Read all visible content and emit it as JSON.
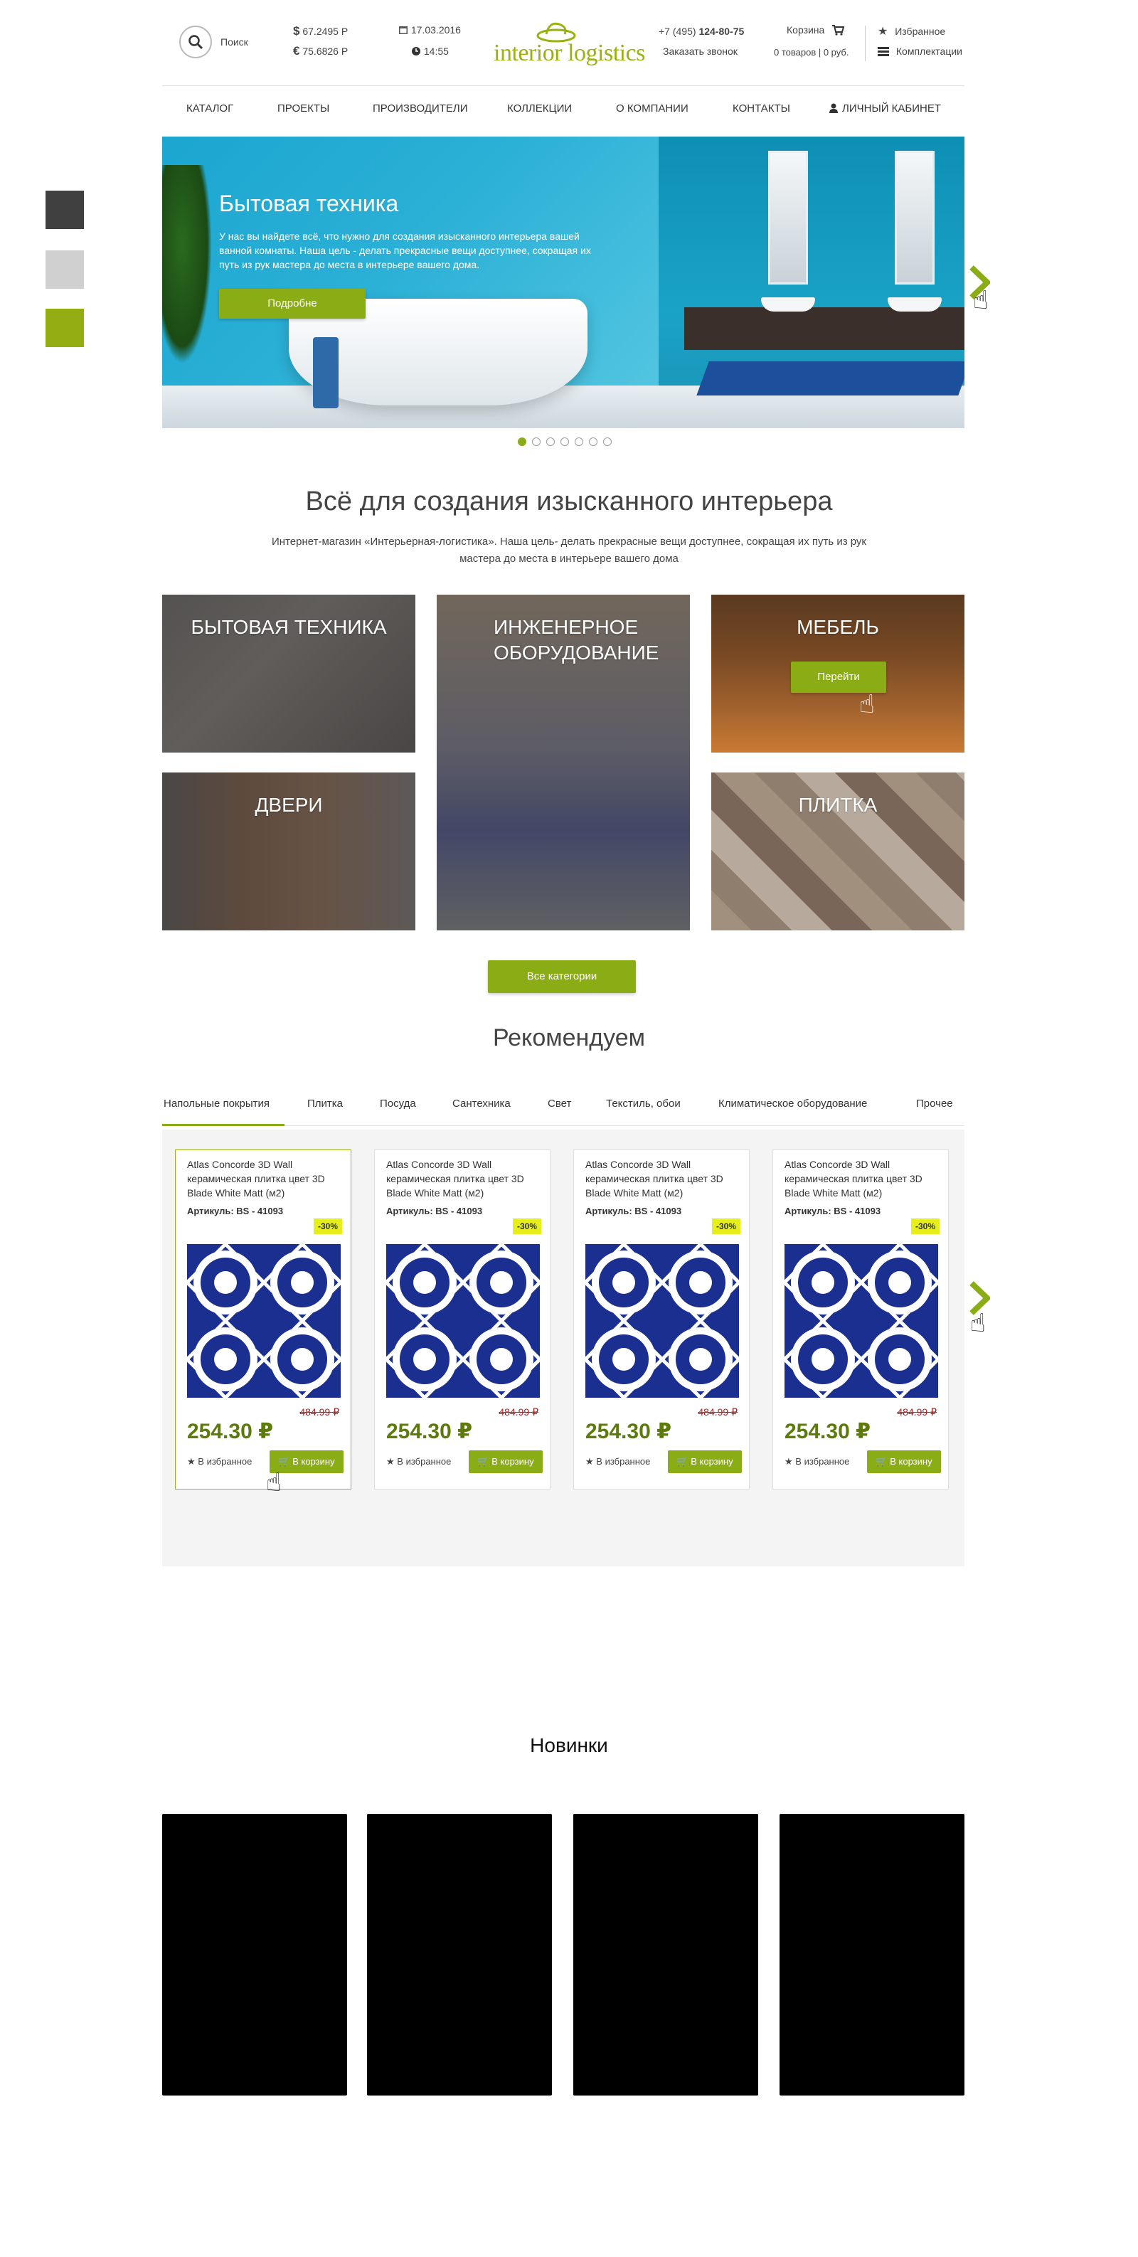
{
  "colors": {
    "accent": "#8aac14",
    "swatch_dark": "#404040",
    "swatch_light": "#d0d0d0",
    "swatch_green": "#94ad12",
    "sale_badge": "#e6ef1a",
    "price": "#5d7a0c"
  },
  "header": {
    "search_label": "Поиск",
    "rates": {
      "usd": "67.2495 Р",
      "eur": "75.6826 Р"
    },
    "date": "17.03.2016",
    "time": "14:55",
    "logo": {
      "word1": "interior",
      "word2": "logistics"
    },
    "phone_prefix": "+7 (495) ",
    "phone_number": "124-80-75",
    "callback": "Заказать звонок",
    "cart_label": "Корзина",
    "cart_summary": "0 товаров | 0 руб.",
    "favorites": "Избранное",
    "kits": "Комплектации"
  },
  "nav": [
    "Каталог",
    "Проекты",
    "Производители",
    "Коллекции",
    "О компании",
    "Контакты",
    "Личный кабинет"
  ],
  "hero": {
    "title": "Бытовая техника",
    "description": "У нас вы найдете всё, что нужно для создания изысканного интерьера вашей ванной комнаты. Наша цель - делать прекрасные вещи доступнее, сокращая их путь из рук мастера до места в интерьере вашего дома.",
    "button": "Подробне",
    "slides": 7,
    "active_slide": 1
  },
  "intro": {
    "title": "Всё для создания изысканного интерьера",
    "text": "Интернет-магазин «Интерьерная-логистика». Наша цель- делать прекрасные вещи доступнее, сокращая их путь из рук мастера до места в интерьере вашего дома"
  },
  "categories": {
    "kitchen": "Бытовая техника",
    "engineering": "Инженерное оборудование",
    "furniture": "Мебель",
    "furniture_button": "Перейти",
    "doors": "Двери",
    "tile": "Плитка",
    "all_button": "Все категории"
  },
  "recommend": {
    "title": "Рекомендуем",
    "tabs": [
      "Напольные покрытия",
      "Плитка",
      "Посуда",
      "Сантехника",
      "Свет",
      "Текстиль, обои",
      "Климатическое оборудование",
      "Прочее"
    ],
    "products": [
      {
        "title": "Atlas Concorde 3D Wall керамическая плитка цвет 3D Blade White Matt (м2)",
        "sku_label": "Артикуль:",
        "sku": "BS - 41093",
        "discount": "-30%",
        "old_price": "484.99 ₽",
        "price": "254.30 ₽",
        "fav": "В избранное",
        "cart": "В корзину"
      },
      {
        "title": "Atlas Concorde 3D Wall керамическая плитка цвет 3D Blade White Matt (м2)",
        "sku_label": "Артикуль:",
        "sku": "BS - 41093",
        "discount": "-30%",
        "old_price": "484.99 ₽",
        "price": "254.30 ₽",
        "fav": "В избранное",
        "cart": "В корзину"
      },
      {
        "title": "Atlas Concorde 3D Wall керамическая плитка цвет 3D Blade White Matt (м2)",
        "sku_label": "Артикуль:",
        "sku": "BS - 41093",
        "discount": "-30%",
        "old_price": "484.99 ₽",
        "price": "254.30 ₽",
        "fav": "В избранное",
        "cart": "В корзину"
      },
      {
        "title": "Atlas Concorde 3D Wall керамическая плитка цвет 3D Blade White Matt (м2)",
        "sku_label": "Артикуль:",
        "sku": "BS - 41093",
        "discount": "-30%",
        "old_price": "484.99 ₽",
        "price": "254.30 ₽",
        "fav": "В избранное",
        "cart": "В корзину"
      }
    ]
  },
  "new_items": {
    "title": "Новинки"
  },
  "icons": [
    "search-icon",
    "dollar-icon",
    "euro-icon",
    "calendar-icon",
    "clock-icon",
    "cart-icon",
    "star-icon",
    "list-icon",
    "user-icon",
    "chevron-right-icon",
    "hand-cursor-icon"
  ]
}
